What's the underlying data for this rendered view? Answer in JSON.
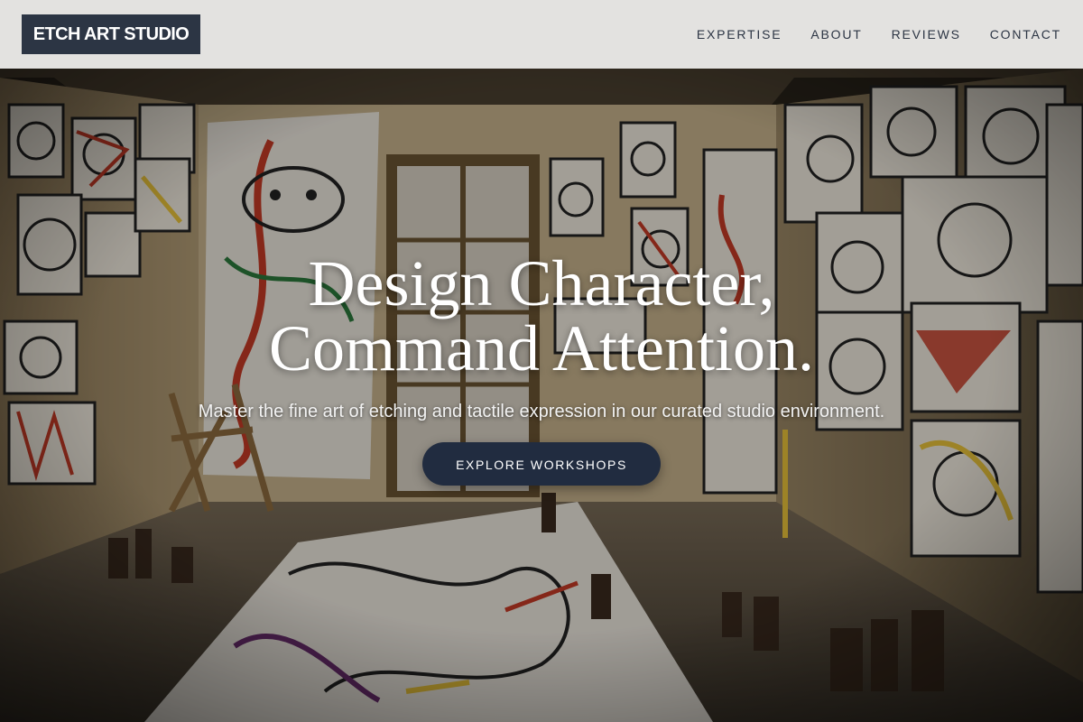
{
  "brand": {
    "logo_text": "ETCH ART STUDIO"
  },
  "nav": {
    "links": [
      {
        "label": "EXPERTISE"
      },
      {
        "label": "ABOUT"
      },
      {
        "label": "REVIEWS"
      },
      {
        "label": "CONTACT"
      }
    ]
  },
  "hero": {
    "title_line1": "Design Character,",
    "title_line2": "Command Attention.",
    "subtitle": "Master the fine art of etching and tactile expression in our curated studio environment.",
    "cta_label": "EXPLORE WORKSHOPS",
    "background_image": "art studio interior with walls covered in expressive face drawings, paint jars on the floor and a window at the back"
  },
  "colors": {
    "navbar_bg": "#e3e2e0",
    "logo_bg": "#2c3544",
    "nav_text": "#2c3544",
    "cta_bg": "#212c40",
    "hero_text": "#ffffff"
  }
}
